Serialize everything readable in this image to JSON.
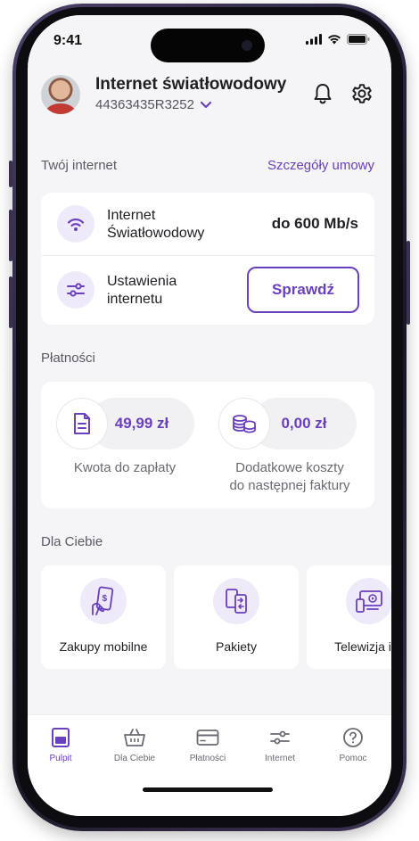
{
  "status_bar": {
    "time": "9:41"
  },
  "header": {
    "title": "Internet światłowodowy",
    "account_number": "44363435R3252"
  },
  "internet_section": {
    "label": "Twój internet",
    "link": "Szczegóły umowy",
    "speed_row": {
      "label_line1": "Internet",
      "label_line2": "Światłowodowy",
      "value": "do 600 Mb/s"
    },
    "settings_row": {
      "label_line1": "Ustawienia",
      "label_line2": "internetu",
      "button": "Sprawdź"
    }
  },
  "payments_section": {
    "label": "Płatności",
    "due": {
      "amount": "49,99 zł",
      "caption": "Kwota do zapłaty"
    },
    "extra": {
      "amount": "0,00 zł",
      "caption_line1": "Dodatkowe koszty",
      "caption_line2": "do następnej faktury"
    }
  },
  "for_you_section": {
    "label": "Dla Ciebie",
    "tiles": [
      {
        "label": "Zakupy mobilne",
        "icon": "mobile-payment-icon"
      },
      {
        "label": "Pakiety",
        "icon": "packages-icon"
      },
      {
        "label": "Telewizja i w",
        "icon": "tv-icon"
      }
    ]
  },
  "bottom_nav": {
    "items": [
      {
        "label": "Pulpit",
        "icon": "dashboard-icon",
        "active": true
      },
      {
        "label": "Dla Ciebie",
        "icon": "basket-icon",
        "active": false
      },
      {
        "label": "Płatności",
        "icon": "card-icon",
        "active": false
      },
      {
        "label": "Internet",
        "icon": "sliders-icon",
        "active": false
      },
      {
        "label": "Pomoc",
        "icon": "help-icon",
        "active": false
      }
    ]
  },
  "colors": {
    "accent": "#6a3fc0",
    "accent_light": "#efeaf9",
    "background": "#f5f5f7"
  }
}
